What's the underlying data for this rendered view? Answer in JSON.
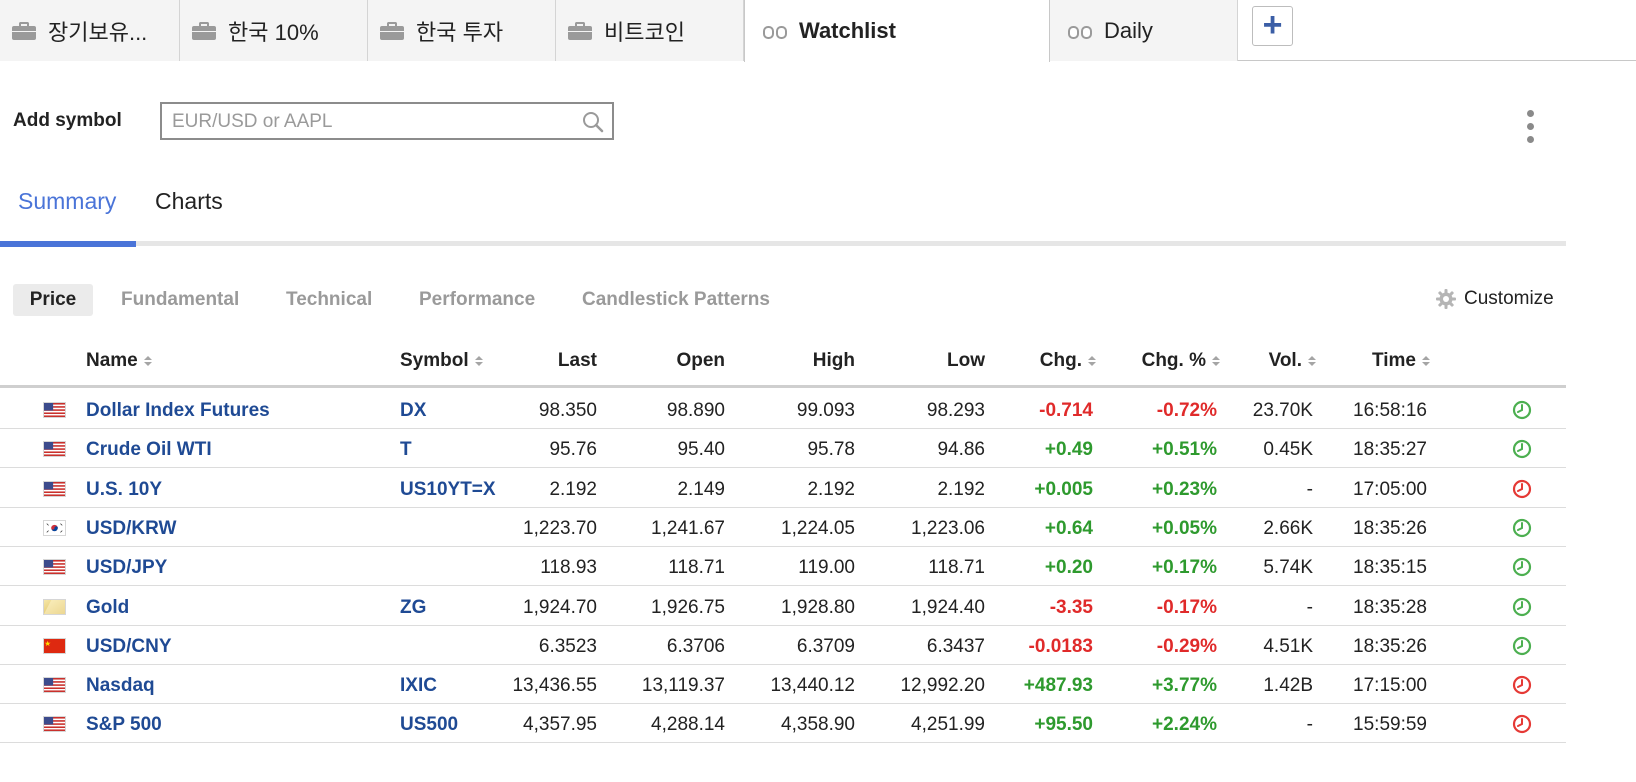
{
  "tabs": [
    {
      "label": "장기보유...",
      "icon": "briefcase-icon"
    },
    {
      "label": "한국 10%",
      "icon": "briefcase-icon"
    },
    {
      "label": "한국 투자",
      "icon": "briefcase-icon"
    },
    {
      "label": "비트코인",
      "icon": "briefcase-icon"
    },
    {
      "label": "Watchlist",
      "icon": "binoculars-icon"
    },
    {
      "label": "Daily",
      "icon": "binoculars-icon"
    }
  ],
  "add_tab_label": "+",
  "add_symbol": {
    "label": "Add symbol",
    "placeholder": "EUR/USD or AAPL"
  },
  "view_tabs": {
    "summary": "Summary",
    "charts": "Charts"
  },
  "sub_tabs": {
    "price": "Price",
    "fundamental": "Fundamental",
    "technical": "Technical",
    "performance": "Performance",
    "candlestick": "Candlestick Patterns"
  },
  "customize_label": "Customize",
  "columns": {
    "name": "Name",
    "symbol": "Symbol",
    "last": "Last",
    "open": "Open",
    "high": "High",
    "low": "Low",
    "chg": "Chg.",
    "chg_pct": "Chg. %",
    "vol": "Vol.",
    "time": "Time"
  },
  "colors": {
    "link": "#1f4a94",
    "positive": "#2e9a2e",
    "negative": "#e02a2a",
    "accent": "#4a74d8",
    "clock_open": "#4caf50",
    "clock_closed": "#e53935"
  },
  "rows": [
    {
      "flag": "us-flag",
      "name": "Dollar Index Futures",
      "symbol": "DX",
      "last": "98.350",
      "open": "98.890",
      "high": "99.093",
      "low": "98.293",
      "chg": "-0.714",
      "chg_pct": "-0.72%",
      "vol": "23.70K",
      "time": "16:58:16",
      "market": "open"
    },
    {
      "flag": "us-flag",
      "name": "Crude Oil WTI",
      "symbol": "T",
      "last": "95.76",
      "open": "95.40",
      "high": "95.78",
      "low": "94.86",
      "chg": "+0.49",
      "chg_pct": "+0.51%",
      "vol": "0.45K",
      "time": "18:35:27",
      "market": "open"
    },
    {
      "flag": "us-flag",
      "name": "U.S. 10Y",
      "symbol": "US10YT=X",
      "last": "2.192",
      "open": "2.149",
      "high": "2.192",
      "low": "2.192",
      "chg": "+0.005",
      "chg_pct": "+0.23%",
      "vol": "-",
      "time": "17:05:00",
      "market": "closed"
    },
    {
      "flag": "kr-flag",
      "name": "USD/KRW",
      "symbol": "",
      "last": "1,223.70",
      "open": "1,241.67",
      "high": "1,224.05",
      "low": "1,223.06",
      "chg": "+0.64",
      "chg_pct": "+0.05%",
      "vol": "2.66K",
      "time": "18:35:26",
      "market": "open"
    },
    {
      "flag": "us-flag",
      "name": "USD/JPY",
      "symbol": "",
      "last": "118.93",
      "open": "118.71",
      "high": "119.00",
      "low": "118.71",
      "chg": "+0.20",
      "chg_pct": "+0.17%",
      "vol": "5.74K",
      "time": "18:35:15",
      "market": "open"
    },
    {
      "flag": "gold-flag",
      "name": "Gold",
      "symbol": "ZG",
      "last": "1,924.70",
      "open": "1,926.75",
      "high": "1,928.80",
      "low": "1,924.40",
      "chg": "-3.35",
      "chg_pct": "-0.17%",
      "vol": "-",
      "time": "18:35:28",
      "market": "open"
    },
    {
      "flag": "cn-flag",
      "name": "USD/CNY",
      "symbol": "",
      "last": "6.3523",
      "open": "6.3706",
      "high": "6.3709",
      "low": "6.3437",
      "chg": "-0.0183",
      "chg_pct": "-0.29%",
      "vol": "4.51K",
      "time": "18:35:26",
      "market": "open"
    },
    {
      "flag": "us-flag",
      "name": "Nasdaq",
      "symbol": "IXIC",
      "last": "13,436.55",
      "open": "13,119.37",
      "high": "13,440.12",
      "low": "12,992.20",
      "chg": "+487.93",
      "chg_pct": "+3.77%",
      "vol": "1.42B",
      "time": "17:15:00",
      "market": "closed"
    },
    {
      "flag": "us-flag",
      "name": "S&P 500",
      "symbol": "US500",
      "last": "4,357.95",
      "open": "4,288.14",
      "high": "4,358.90",
      "low": "4,251.99",
      "chg": "+95.50",
      "chg_pct": "+2.24%",
      "vol": "-",
      "time": "15:59:59",
      "market": "closed"
    }
  ]
}
